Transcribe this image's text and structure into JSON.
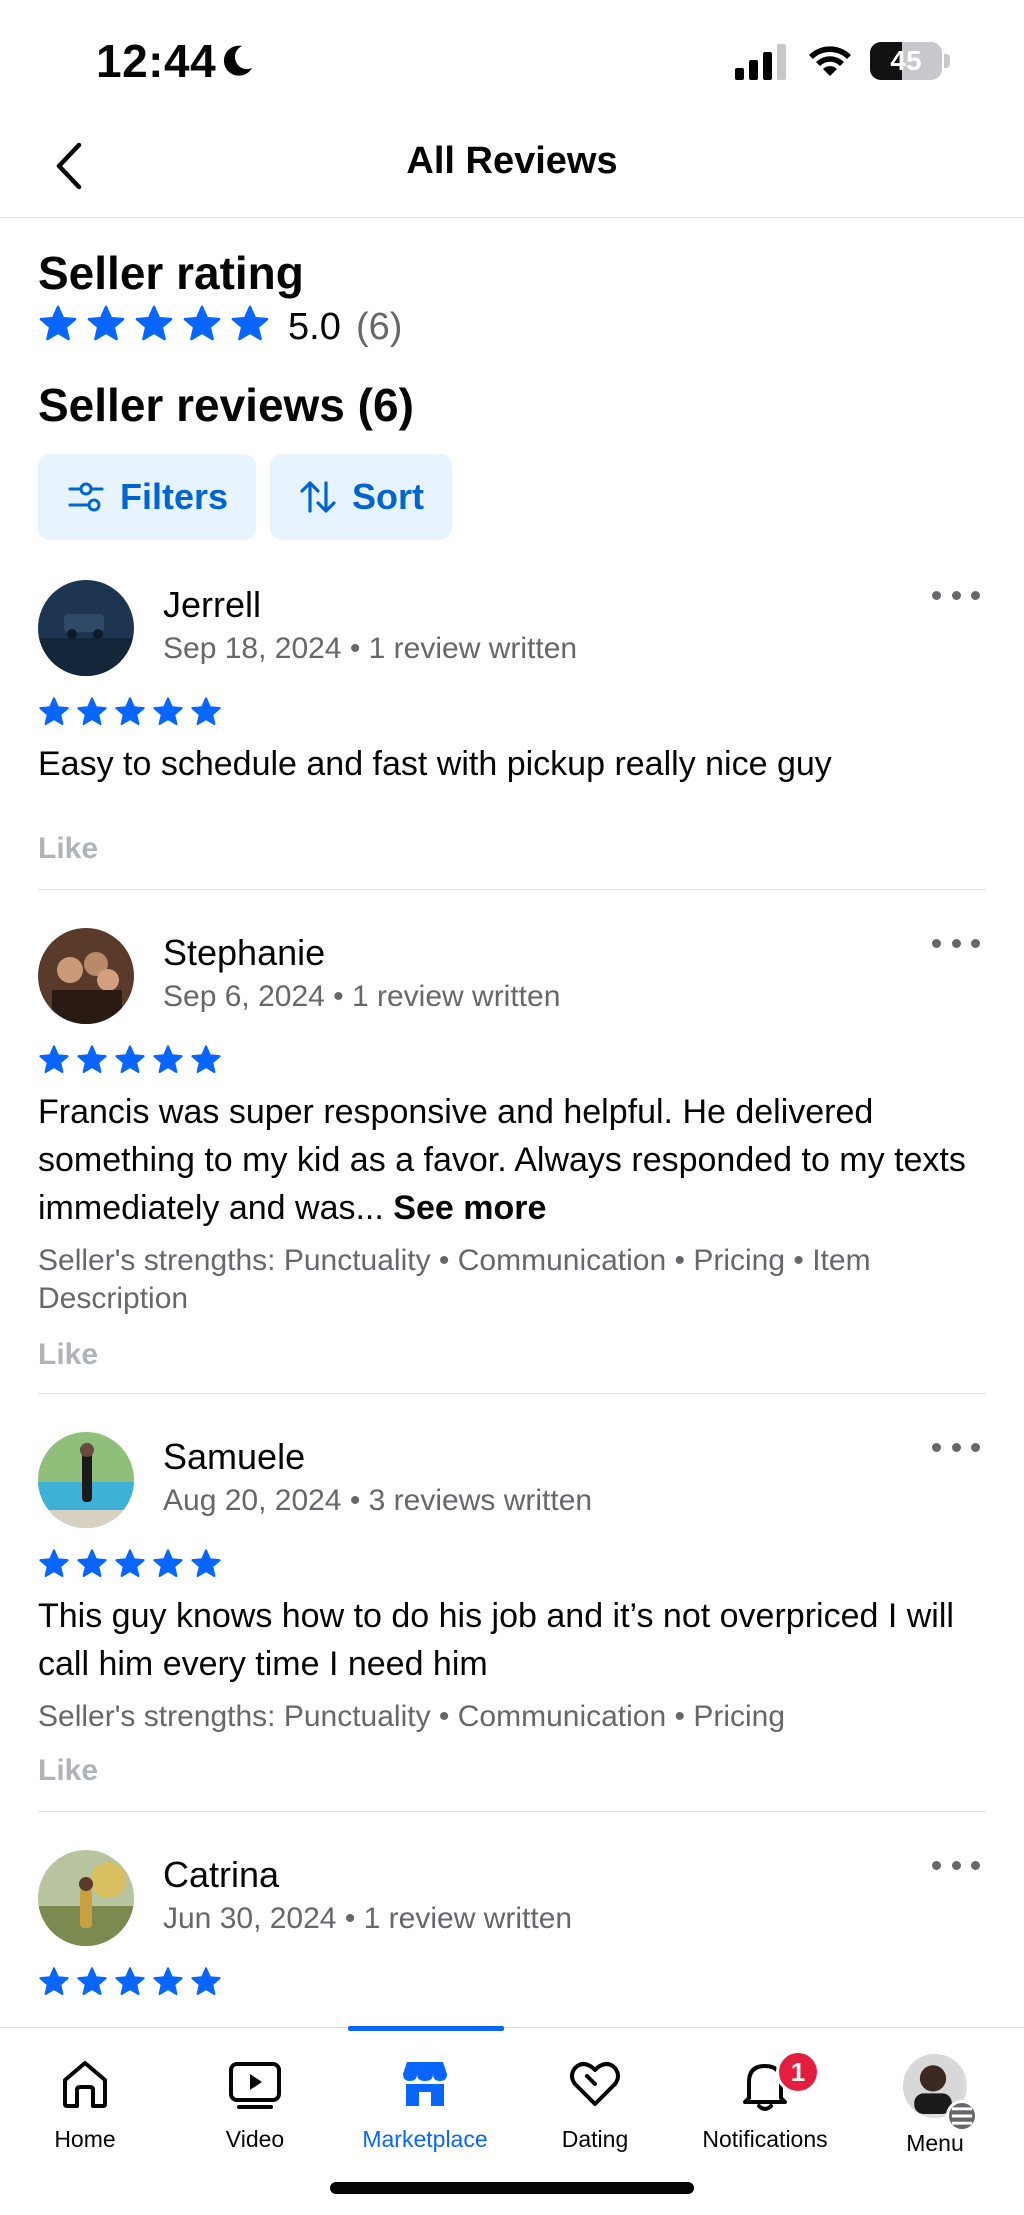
{
  "status_bar": {
    "time": "12:44",
    "battery": "45",
    "battery_level": 0.45
  },
  "header": {
    "title": "All Reviews",
    "back_icon": "chevron-left-icon"
  },
  "rating": {
    "title": "Seller rating",
    "value": "5.0",
    "count": "(6)",
    "stars": 5,
    "star_color": "#0866ff"
  },
  "reviews_section": {
    "title": "Seller reviews (6)",
    "filters_label": "Filters",
    "sort_label": "Sort"
  },
  "reviews": [
    {
      "name": "Jerrell",
      "meta": "Sep 18, 2024 • 1 review written",
      "stars": 5,
      "text": "Easy to schedule and fast with pickup really nice guy",
      "like": "Like"
    },
    {
      "name": "Stephanie",
      "meta": "Sep 6, 2024 • 1 review written",
      "stars": 5,
      "text": "Francis was super responsive and helpful.  He delivered something to my kid as a favor.  Always responded to my texts immediately and was...",
      "see_more": "See more",
      "strengths": "Seller's strengths: Punctuality • Communication • Pricing • Item Description",
      "like": "Like"
    },
    {
      "name": "Samuele",
      "meta": "Aug 20, 2024 • 3 reviews written",
      "stars": 5,
      "text": "This guy knows how to do his job and it’s not overpriced I will call him every time I need him",
      "strengths": "Seller's strengths: Punctuality • Communication • Pricing",
      "like": "Like"
    },
    {
      "name": "Catrina",
      "meta": "Jun 30, 2024 • 1 review written",
      "stars": 5
    }
  ],
  "bottom_nav": {
    "items": [
      {
        "label": "Home",
        "icon": "home-icon"
      },
      {
        "label": "Video",
        "icon": "video-icon"
      },
      {
        "label": "Marketplace",
        "icon": "marketplace-icon",
        "active": true
      },
      {
        "label": "Dating",
        "icon": "heart-icon"
      },
      {
        "label": "Notifications",
        "icon": "bell-icon",
        "badge": "1"
      },
      {
        "label": "Menu",
        "icon": "avatar"
      }
    ],
    "accent": "#0866ff",
    "badge_color": "#e41e3f"
  }
}
